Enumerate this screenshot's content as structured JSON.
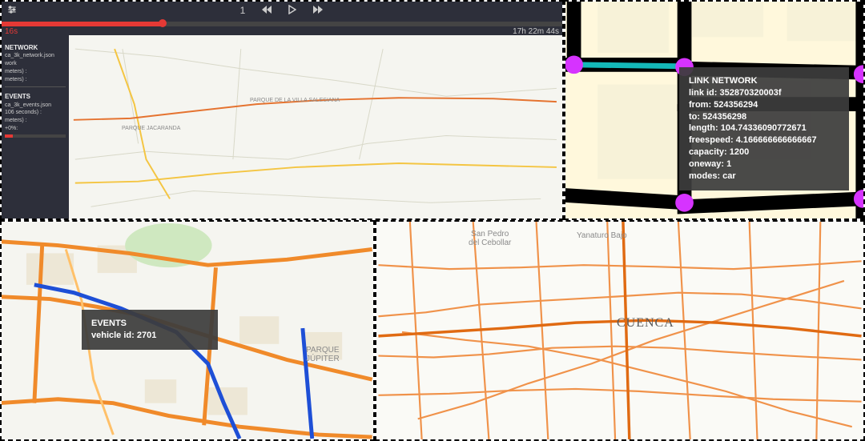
{
  "playback": {
    "speed": "1",
    "current_time": "16s",
    "total_time": "17h 22m 44s"
  },
  "sidebar": {
    "section1_title": "NETWORK",
    "section1_lines": [
      "ca_3k_network.json",
      "work",
      "meters) :",
      "",
      "meters) :"
    ],
    "section2_title": "EVENTS",
    "section2_lines": [
      "ca_3k_events.json",
      "106 seconds) :",
      "",
      "meters) :",
      "",
      "+0%:"
    ]
  },
  "link_tooltip": {
    "title": "LINK NETWORK",
    "rows": [
      "link id: 352870320003f",
      "from: 524356294",
      "to: 524356298",
      "length: 104.74336090772671",
      "freespeed: 4.166666666666667",
      "capacity: 1200",
      "oneway: 1",
      "modes: car"
    ]
  },
  "events_tooltip": {
    "title": "EVENTS",
    "rows": [
      "vehicle id: 2701"
    ]
  },
  "labels": {
    "cuenca": "CUENCA",
    "san_pedro": "San Pedro\ndel Cebollar",
    "yanaturo": "Yanaturo Bajo",
    "jupiter": "PARQUE JÚPITER",
    "jacaranda": "PARQUE JACARANDA",
    "salesiana": "PARQUE DE LA VILLA SALESIANA"
  }
}
